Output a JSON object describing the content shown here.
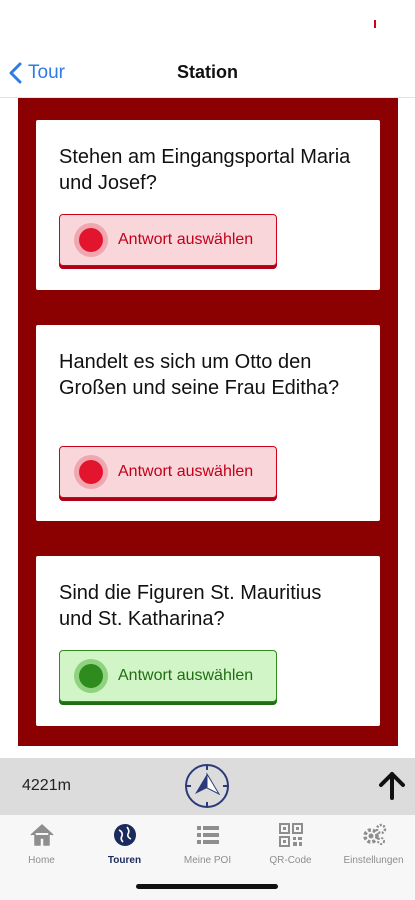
{
  "nav": {
    "back_label": "Tour",
    "title": "Station"
  },
  "questions": [
    {
      "text": "Stehen am Eingangsportal Maria und Josef?",
      "answer_label": "Antwort auswählen",
      "state": "red"
    },
    {
      "text": "Handelt es sich um Otto den Großen und seine Frau Editha?",
      "answer_label": "Antwort auswählen",
      "state": "red"
    },
    {
      "text": "Sind die Figuren St. Mauritius und St. Katharina?",
      "answer_label": "Antwort auswählen",
      "state": "green"
    }
  ],
  "distance": {
    "value": "4221m"
  },
  "icons": {
    "compass": "compass-icon",
    "scroll_top": "arrow-up-icon"
  },
  "tabs": [
    {
      "label": "Home",
      "icon": "home-icon",
      "active": false
    },
    {
      "label": "Touren",
      "icon": "globe-icon",
      "active": true
    },
    {
      "label": "Meine POI",
      "icon": "list-icon",
      "active": false
    },
    {
      "label": "QR-Code",
      "icon": "qr-code-icon",
      "active": false
    },
    {
      "label": "Einstellungen",
      "icon": "gear-icon",
      "active": false
    }
  ],
  "colors": {
    "content_bg": "#8b0000",
    "accent_blue": "#2f7ae5",
    "answer_red": "#e3142e",
    "answer_green": "#2e8b1e"
  }
}
